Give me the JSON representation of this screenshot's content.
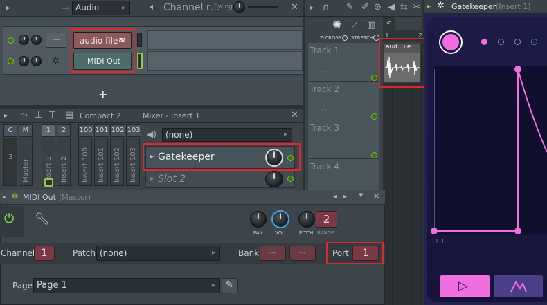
{
  "top_toolbar": {
    "audio_select": "Audio",
    "channel_rack_title": "Channel r…",
    "swing_label": "Swing"
  },
  "channel_rack": {
    "channel_placeholder": "---",
    "audio_file_button": "audio file",
    "midi_out_button": "MIDI Out",
    "add_button": "+"
  },
  "mixer": {
    "view_mode": "Compact 2",
    "title": "Mixer - Insert 1",
    "headers": [
      "C",
      "M",
      "1",
      "2",
      "100",
      "101",
      "102",
      "103"
    ],
    "strips": [
      "Master",
      "Insert 1",
      "Insert 2",
      "Insert 100",
      "Insert 101",
      "Insert 102",
      "Insert 103"
    ],
    "master_number": "3",
    "input_select": "(none)",
    "slot_1": "Gatekeeper",
    "slot_2": "Slot 2"
  },
  "playlist": {
    "zcross_label": "Z-CROSS",
    "stretch_label": "STRETCH",
    "ruler_1": "1",
    "ruler_2": "2",
    "tracks": [
      "Track 1",
      "Track 2",
      "Track 3",
      "Track 4"
    ],
    "track_dots": "...",
    "clip_label": "aud…ile"
  },
  "midi_out": {
    "title": "MIDI Out",
    "subtitle": "(Master)",
    "pan_label": "PAN",
    "vol_label": "VOL",
    "pitch_label": "PITCH",
    "range_value": "2",
    "range_label": "RANGE",
    "channel_label": "Channel",
    "channel_value": "1",
    "patch_label": "Patch",
    "patch_value": "(none)",
    "bank_label": "Bank",
    "bank_value_1": "---",
    "bank_value_2": "---",
    "port_label": "Port",
    "port_value": "1",
    "page_label": "Page",
    "page_value": "Page 1"
  },
  "gatekeeper": {
    "title": "Gatekeeper",
    "subtitle": "(Insert 1)",
    "grid_label": "1.1",
    "accent_color": "#f06ee0",
    "panel_color": "#1f1c4a"
  },
  "colors": {
    "highlight": "#e0262b",
    "led_green": "#7ebd3a",
    "counter_red": "#7a3a45"
  }
}
